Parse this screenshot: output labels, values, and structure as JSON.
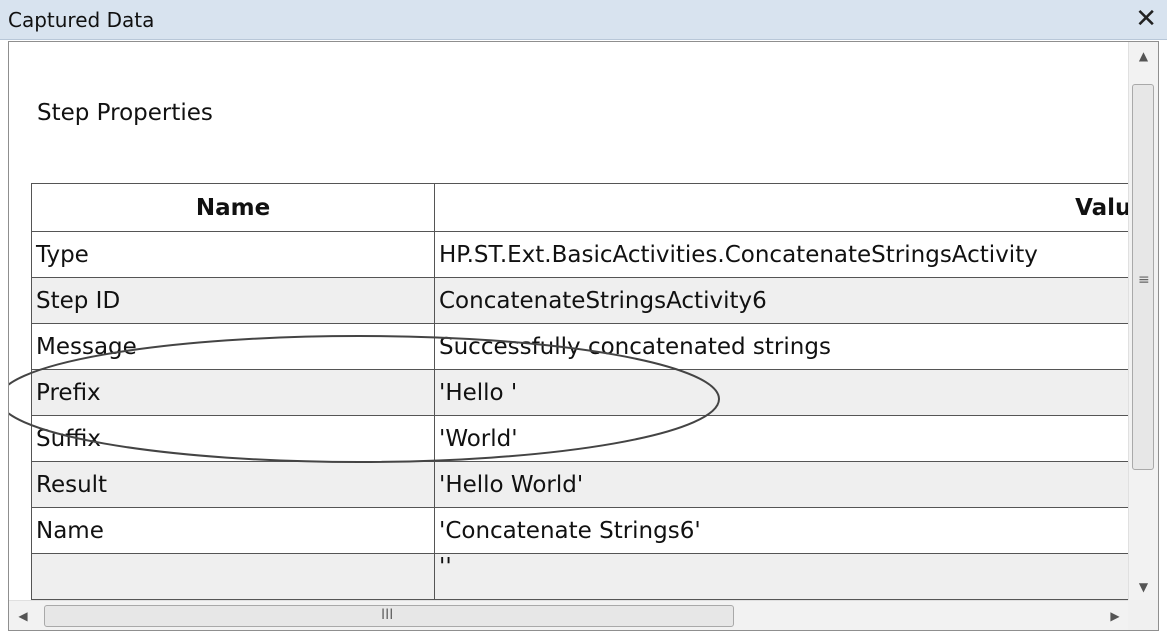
{
  "window": {
    "title": "Captured Data",
    "close_icon": "✕"
  },
  "section": {
    "heading": "Step Properties"
  },
  "table": {
    "columns": [
      "Name",
      "Value"
    ],
    "rows": [
      {
        "name": "Type",
        "value": "HP.ST.Ext.BasicActivities.ConcatenateStringsActivity"
      },
      {
        "name": "Step ID",
        "value": "ConcatenateStringsActivity6"
      },
      {
        "name": "Message",
        "value": "Successfully concatenated strings"
      },
      {
        "name": "Prefix",
        "value": "'Hello '"
      },
      {
        "name": "Suffix",
        "value": "'World'"
      },
      {
        "name": "Result",
        "value": "'Hello World'"
      },
      {
        "name": "Name",
        "value": "'Concatenate Strings6'"
      },
      {
        "name": "",
        "value": "''"
      }
    ]
  },
  "scrollbars": {
    "up_icon": "▲",
    "down_icon": "▼",
    "left_icon": "◀",
    "right_icon": "▶",
    "v_grip": "≡",
    "h_grip": "III"
  },
  "annotation": {
    "color": "#444444"
  }
}
